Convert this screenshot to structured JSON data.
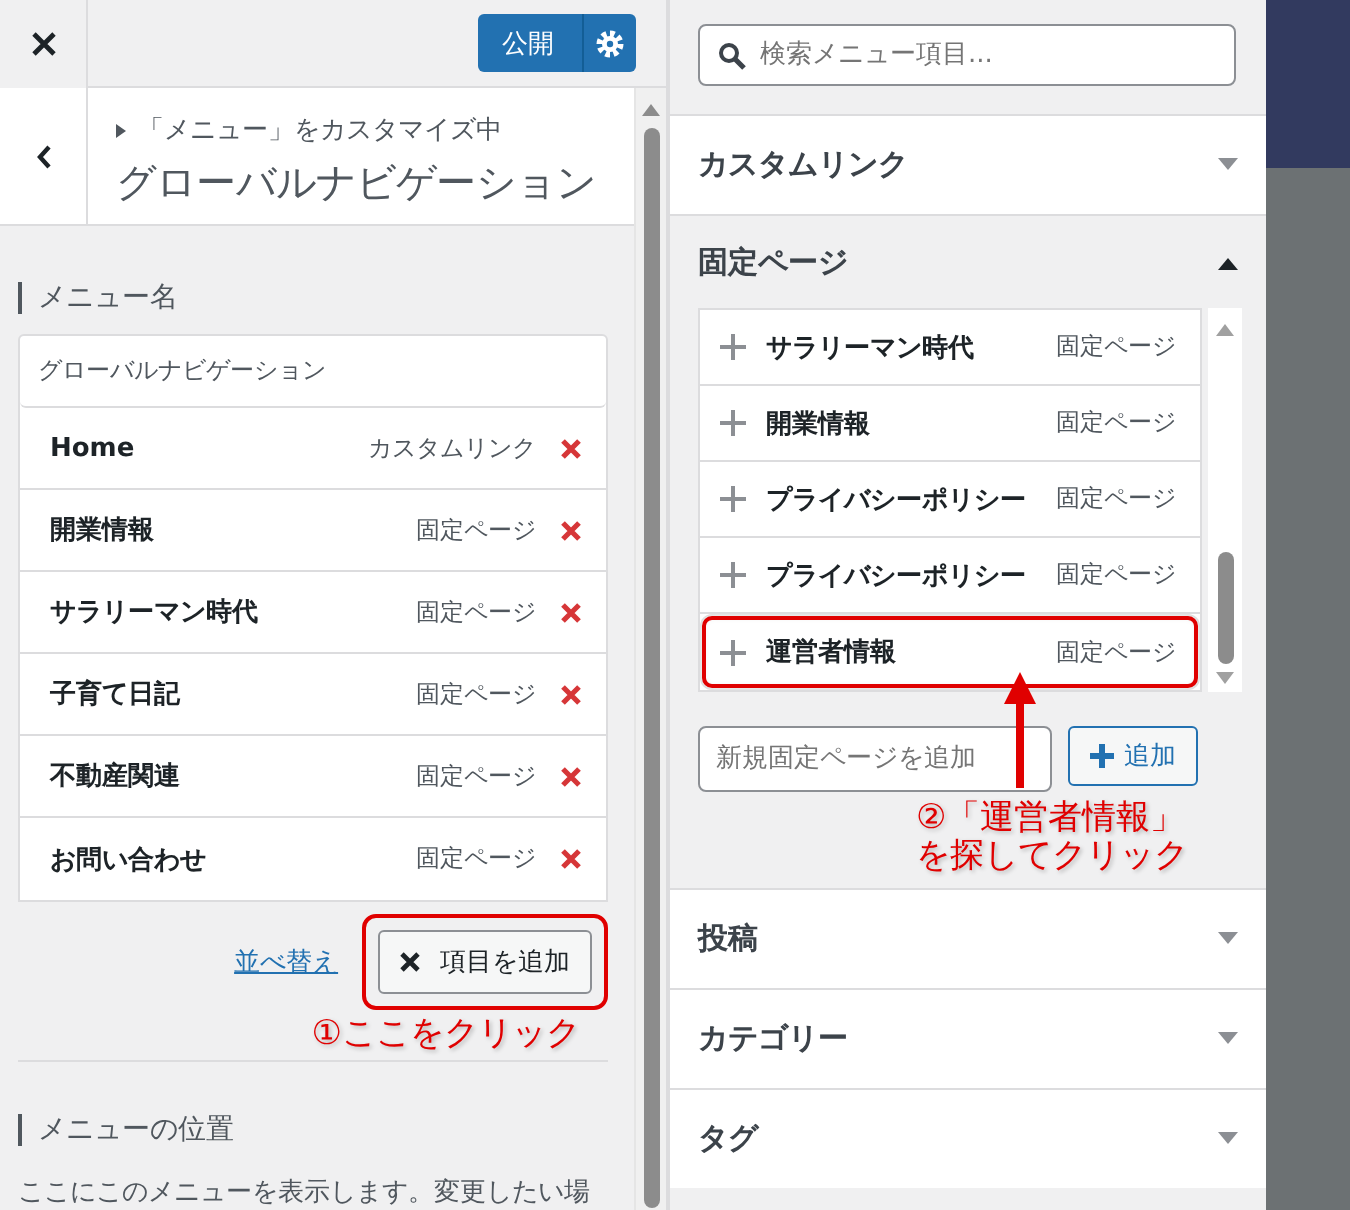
{
  "header": {
    "publish_button": "公開"
  },
  "section": {
    "breadcrumb": "「メニュー」をカスタマイズ中",
    "title": "グローバルナビゲーション"
  },
  "menu_name": {
    "label": "メニュー名",
    "value": "グローバルナビゲーション"
  },
  "menu_items": [
    {
      "title": "Home",
      "type": "カスタムリンク"
    },
    {
      "title": "開業情報",
      "type": "固定ページ"
    },
    {
      "title": "サラリーマン時代",
      "type": "固定ページ"
    },
    {
      "title": "子育て日記",
      "type": "固定ページ"
    },
    {
      "title": "不動産関連",
      "type": "固定ページ"
    },
    {
      "title": "お問い合わせ",
      "type": "固定ページ"
    }
  ],
  "reorder_link": "並べ替え",
  "add_items_button": {
    "label": "項目を追加",
    "highlighted": true
  },
  "annotation_1": "①ここをクリック",
  "menu_location": {
    "label": "メニューの位置",
    "description": "ここにこのメニューを表示します。変更したい場"
  },
  "search": {
    "placeholder": "検索メニュー項目..."
  },
  "panels": [
    {
      "title": "カスタムリンク",
      "expanded": false
    },
    {
      "title": "固定ページ",
      "expanded": true,
      "items": [
        {
          "title": "サラリーマン時代",
          "type": "固定ページ",
          "highlighted": false
        },
        {
          "title": "開業情報",
          "type": "固定ページ",
          "highlighted": false
        },
        {
          "title": "プライバシーポリシー",
          "type": "固定ページ",
          "highlighted": false
        },
        {
          "title": "プライバシーポリシー",
          "type": "固定ページ",
          "highlighted": false
        },
        {
          "title": "運営者情報",
          "type": "固定ページ",
          "highlighted": true
        }
      ],
      "new_page_placeholder": "新規固定ページを追加",
      "add_button": "追加"
    },
    {
      "title": "投稿",
      "expanded": false
    },
    {
      "title": "カテゴリー",
      "expanded": false
    },
    {
      "title": "タグ",
      "expanded": false
    }
  ],
  "annotation_2": [
    "②「運営者情報」",
    "を探してクリック"
  ]
}
